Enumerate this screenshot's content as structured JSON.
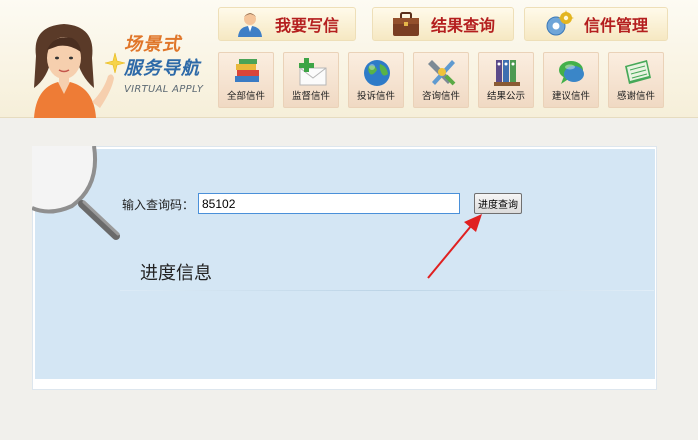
{
  "brand": {
    "line1": "场景式",
    "line2": "服务导航",
    "line3": "VIRTUAL APPLY"
  },
  "main_nav": [
    {
      "label": "我要写信",
      "icon": "person-icon"
    },
    {
      "label": "结果查询",
      "icon": "briefcase-icon"
    },
    {
      "label": "信件管理",
      "icon": "gear-icon"
    }
  ],
  "categories": [
    {
      "label": "全部信件",
      "icon": "books-icon"
    },
    {
      "label": "监督信件",
      "icon": "envelope-plus-icon"
    },
    {
      "label": "投诉信件",
      "icon": "globe-icon"
    },
    {
      "label": "咨询信件",
      "icon": "tools-icon"
    },
    {
      "label": "结果公示",
      "icon": "binders-icon"
    },
    {
      "label": "建议信件",
      "icon": "chat-bubble-icon"
    },
    {
      "label": "感谢信件",
      "icon": "notebook-icon"
    }
  ],
  "query": {
    "label": "输入查询码：",
    "value": "85102",
    "button_label": "进度查询"
  },
  "progress": {
    "title": "进度信息"
  },
  "colors": {
    "brand_orange": "#e0762a",
    "brand_blue": "#2d6aa8",
    "nav_red": "#b41e1e",
    "panel_blue": "#d4e6f4",
    "annotation_red": "#e02020"
  }
}
